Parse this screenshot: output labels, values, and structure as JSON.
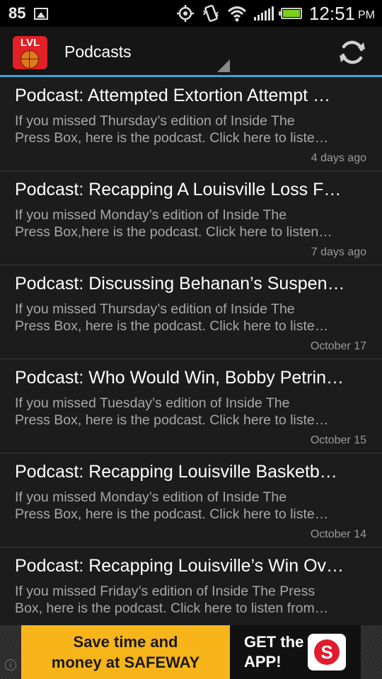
{
  "status_bar": {
    "battery_level": "85",
    "time": "12:51",
    "ampm": "PM",
    "icons": [
      "image-icon",
      "gps-icon",
      "vibrate-icon",
      "wifi-icon",
      "signal-icon",
      "battery-icon"
    ],
    "battery_color": "#7ad11b"
  },
  "action_bar": {
    "logo_text": "LVL",
    "title": "Podcasts",
    "accent_color": "#3aa3d8",
    "logo_color": "#e22026"
  },
  "posts": [
    {
      "title": "Podcast: Attempted Extortion Attempt …",
      "desc_line1": "If you missed Thursday’s edition of Inside The",
      "desc_line2": "Press Box, here is the podcast. Click here to liste…",
      "date": "4 days ago"
    },
    {
      "title": "Podcast: Recapping A Louisville Loss F…",
      "desc_line1": "If you missed Monday’s edition of Inside The",
      "desc_line2": "Press Box,here is the podcast. Click here to listen…",
      "date": "7 days ago"
    },
    {
      "title": "Podcast: Discussing Behanan’s Suspen…",
      "desc_line1": "If you missed Thursday’s edition of Inside The",
      "desc_line2": "Press Box, here is the podcast. Click here to liste…",
      "date": "October 17"
    },
    {
      "title": "Podcast: Who Would Win, Bobby Petrin…",
      "desc_line1": "If you missed Tuesday’s edition of Inside The",
      "desc_line2": "Press Box, here is the podcast. Click here to liste…",
      "date": "October 15"
    },
    {
      "title": "Podcast: Recapping Louisville Basketb…",
      "desc_line1": "If you missed Monday’s edition of Inside The",
      "desc_line2": "Press Box, here is the podcast. Click here to liste…",
      "date": "October 14"
    },
    {
      "title": "Podcast: Recapping Louisville’s Win Ov…",
      "desc_line1": "If you missed Friday’s edition of Inside The Press",
      "desc_line2": "Box, here is the podcast. Click here to listen from…",
      "date": ""
    }
  ],
  "ad": {
    "line1": "Save time and",
    "line2": "money at SAFEWAY",
    "cta_line1": "GET the",
    "cta_line2": "APP!",
    "left_color": "#f7b51a",
    "brand_color": "#e21b2d",
    "info_glyph": "i"
  }
}
